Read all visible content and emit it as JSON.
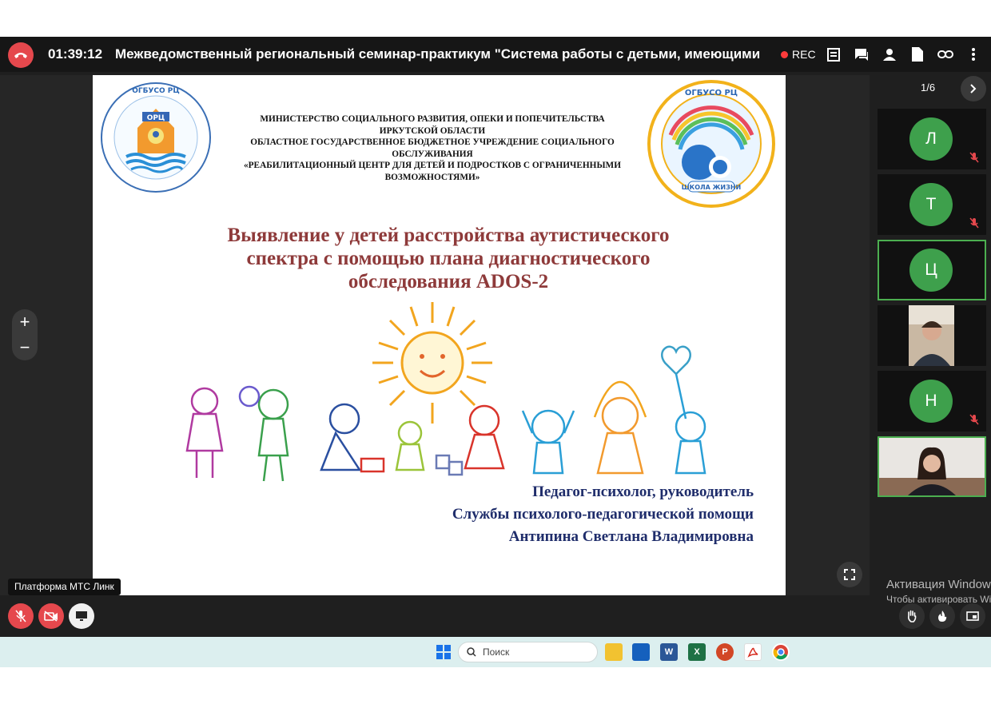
{
  "meeting": {
    "timer": "01:39:12",
    "title": "Межведомственный региональный семинар-практикум \"Система работы с детьми, имеющими расстрой",
    "rec_label": "REC"
  },
  "slide": {
    "org_lines": [
      "МИНИСТЕРСТВО СОЦИАЛЬНОГО РАЗВИТИЯ, ОПЕКИ И ПОПЕЧИТЕЛЬСТВА",
      "ИРКУТСКОЙ ОБЛАСТИ",
      "ОБЛАСТНОЕ ГОСУДАРСТВЕННОЕ БЮДЖЕТНОЕ УЧРЕЖДЕНИЕ СОЦИАЛЬНОГО",
      "ОБСЛУЖИВАНИЯ",
      "«РЕАБИЛИТАЦИОННЫЙ ЦЕНТР ДЛЯ ДЕТЕЙ И ПОДРОСТКОВ С ОГРАНИЧЕННЫМИ",
      "ВОЗМОЖНОСТЯМИ»"
    ],
    "title_lines": [
      "Выявление у детей расстройства аутистического",
      "спектра с помощью плана диагностического",
      "обследования ADOS-2"
    ],
    "author_lines": [
      "Педагог-психолог, руководитель",
      "Службы психолого-педагогической помощи",
      "Антипина Светлана Владимировна"
    ],
    "logo_left": {
      "top": "ОГБУСО РЦ",
      "center": "ОРЦ"
    },
    "logo_right": {
      "top": "ОГБУСО РЦ",
      "center": "ШКОЛА ЖИЗНИ"
    }
  },
  "pager": {
    "label": "1/6"
  },
  "participants": [
    {
      "initial": "Л",
      "muted": true
    },
    {
      "initial": "Т",
      "muted": true
    },
    {
      "initial": "Ц",
      "muted": false,
      "active": true
    },
    {
      "initial": "",
      "video": true
    },
    {
      "initial": "Н",
      "muted": true
    },
    {
      "initial": "",
      "video": true,
      "active": true
    }
  ],
  "tooltip": "Платформа МТС Линк",
  "activation": {
    "line1": "Активация Windows",
    "line2": "Чтобы активировать Windows"
  },
  "taskbar": {
    "search_placeholder": "Поиск"
  },
  "colors": {
    "accent_red": "#e5484d",
    "active_green": "#4caf50",
    "avatar_green": "#3ea04c",
    "title_red": "#8e3a3a",
    "author_blue": "#1f2d6b"
  }
}
